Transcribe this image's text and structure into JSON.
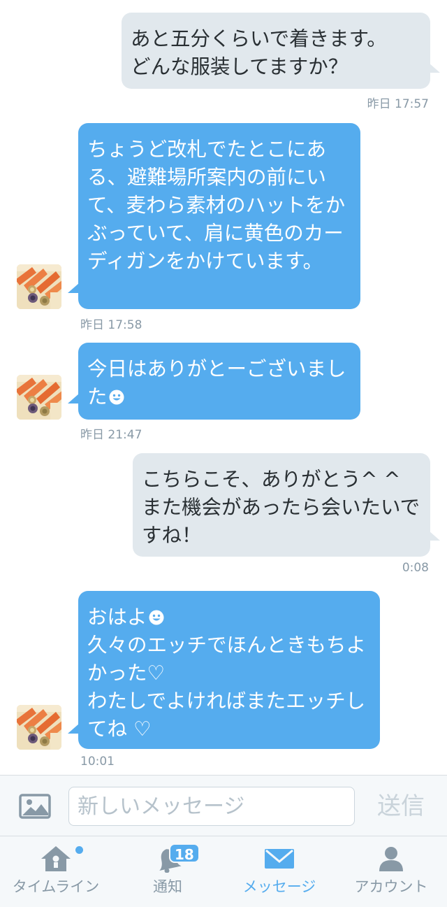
{
  "messages": [
    {
      "direction": "out",
      "text": "あと五分くらいで着きます。\nどんな服装してますか？",
      "time": "昨日 17:57"
    },
    {
      "direction": "in",
      "text": "ちょうど改札でたとこにある、避難場所案内の前にいて、麦わら素材のハットをかぶっていて、肩に黄色のカーディガンをかけています。",
      "time": "昨日 17:58"
    },
    {
      "direction": "in",
      "text": "今日はありがとーございました",
      "time": "昨日 21:47"
    },
    {
      "direction": "out",
      "text": "こちらこそ、ありがとう^ ^\nまた機会があったら会いたいですね！",
      "time": "0:08"
    },
    {
      "direction": "in",
      "text": "おはよ",
      "text2": "久々のエッチでほんときもちよかった♡\nわたしでよければまたエッチしてね ♡",
      "time": "10:01"
    }
  ],
  "composer": {
    "placeholder": "新しいメッセージ",
    "value": "",
    "send_label": "送信"
  },
  "tabs": [
    {
      "label": "タイムライン",
      "icon": "home-icon"
    },
    {
      "label": "通知",
      "icon": "bell-icon",
      "badge": "18"
    },
    {
      "label": "メッセージ",
      "icon": "envelope-icon",
      "active": true
    },
    {
      "label": "アカウント",
      "icon": "person-icon"
    }
  ],
  "colors": {
    "accent": "#55acee",
    "incoming_bubble": "#55acee",
    "outgoing_bubble": "#e1e8ed",
    "muted": "#8899a6"
  }
}
